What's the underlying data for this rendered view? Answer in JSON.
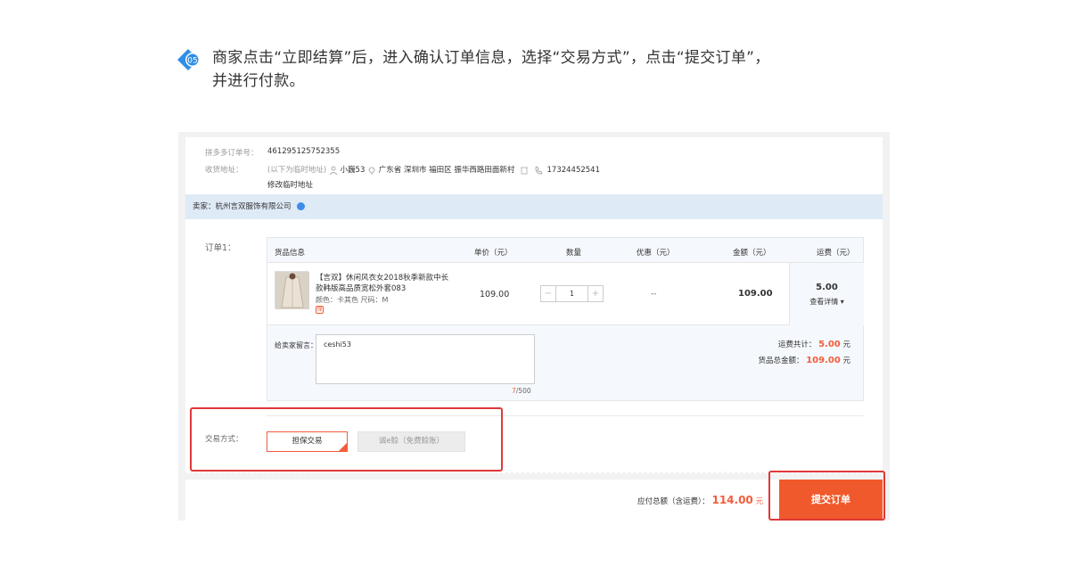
{
  "step": {
    "badge": "05",
    "line1": "商家点击“立即结算”后，进入确认订单信息，选择“交易方式”，点击“提交订单”，",
    "line2": "并进行付款。"
  },
  "order_info": {
    "order_no_label": "拼多多订单号：",
    "order_no": "461295125752355",
    "address_label": "收货地址：",
    "address_hint": "(以下为临时地址)",
    "receiver": "小巍53",
    "address": "广东省 深圳市 福田区 振华西路田面新村",
    "phone": "17324452541",
    "edit_link": "修改临时地址"
  },
  "seller": {
    "label": "卖家：杭州言双服饰有限公司"
  },
  "order": {
    "label": "订单1：",
    "headers": {
      "goods": "货品信息",
      "price": "单价（元）",
      "qty": "数量",
      "discount": "优惠（元）",
      "amount": "金额（元）",
      "shipping": "运费（元）"
    },
    "item": {
      "title": "【言双】休闲风衣女2018秋季新款中长款韩版高品质宽松外套083",
      "spec": "颜色：卡其色    尺码：M",
      "tag": "保",
      "price": "109.00",
      "minus": "−",
      "qty": "1",
      "plus": "+",
      "discount": "--",
      "amount": "109.00",
      "shipping_fee": "5.00",
      "shipping_detail": "查看详情 ▾"
    },
    "message": {
      "label": "给卖家留言：",
      "value": "ceshi53",
      "count_current": "7",
      "count_max": "/500"
    },
    "summary": {
      "freight_label": "运费共计：",
      "freight_value": "5.00",
      "goods_total_label": "货品总金额：",
      "goods_total_value": "109.00",
      "unit": "元"
    }
  },
  "trade": {
    "label": "交易方式：",
    "option_guarantee": "担保交易",
    "option_credit": "诚e赊（免费赊账）"
  },
  "footer": {
    "total_label": "应付总额（含运费）：",
    "total_value": "114.00",
    "unit": "元",
    "submit": "提交订单"
  },
  "colors": {
    "accent": "#f0592b",
    "highlight": "#e03838",
    "seller_bar": "#dfeaf7",
    "badge": "#2f8fe6"
  }
}
